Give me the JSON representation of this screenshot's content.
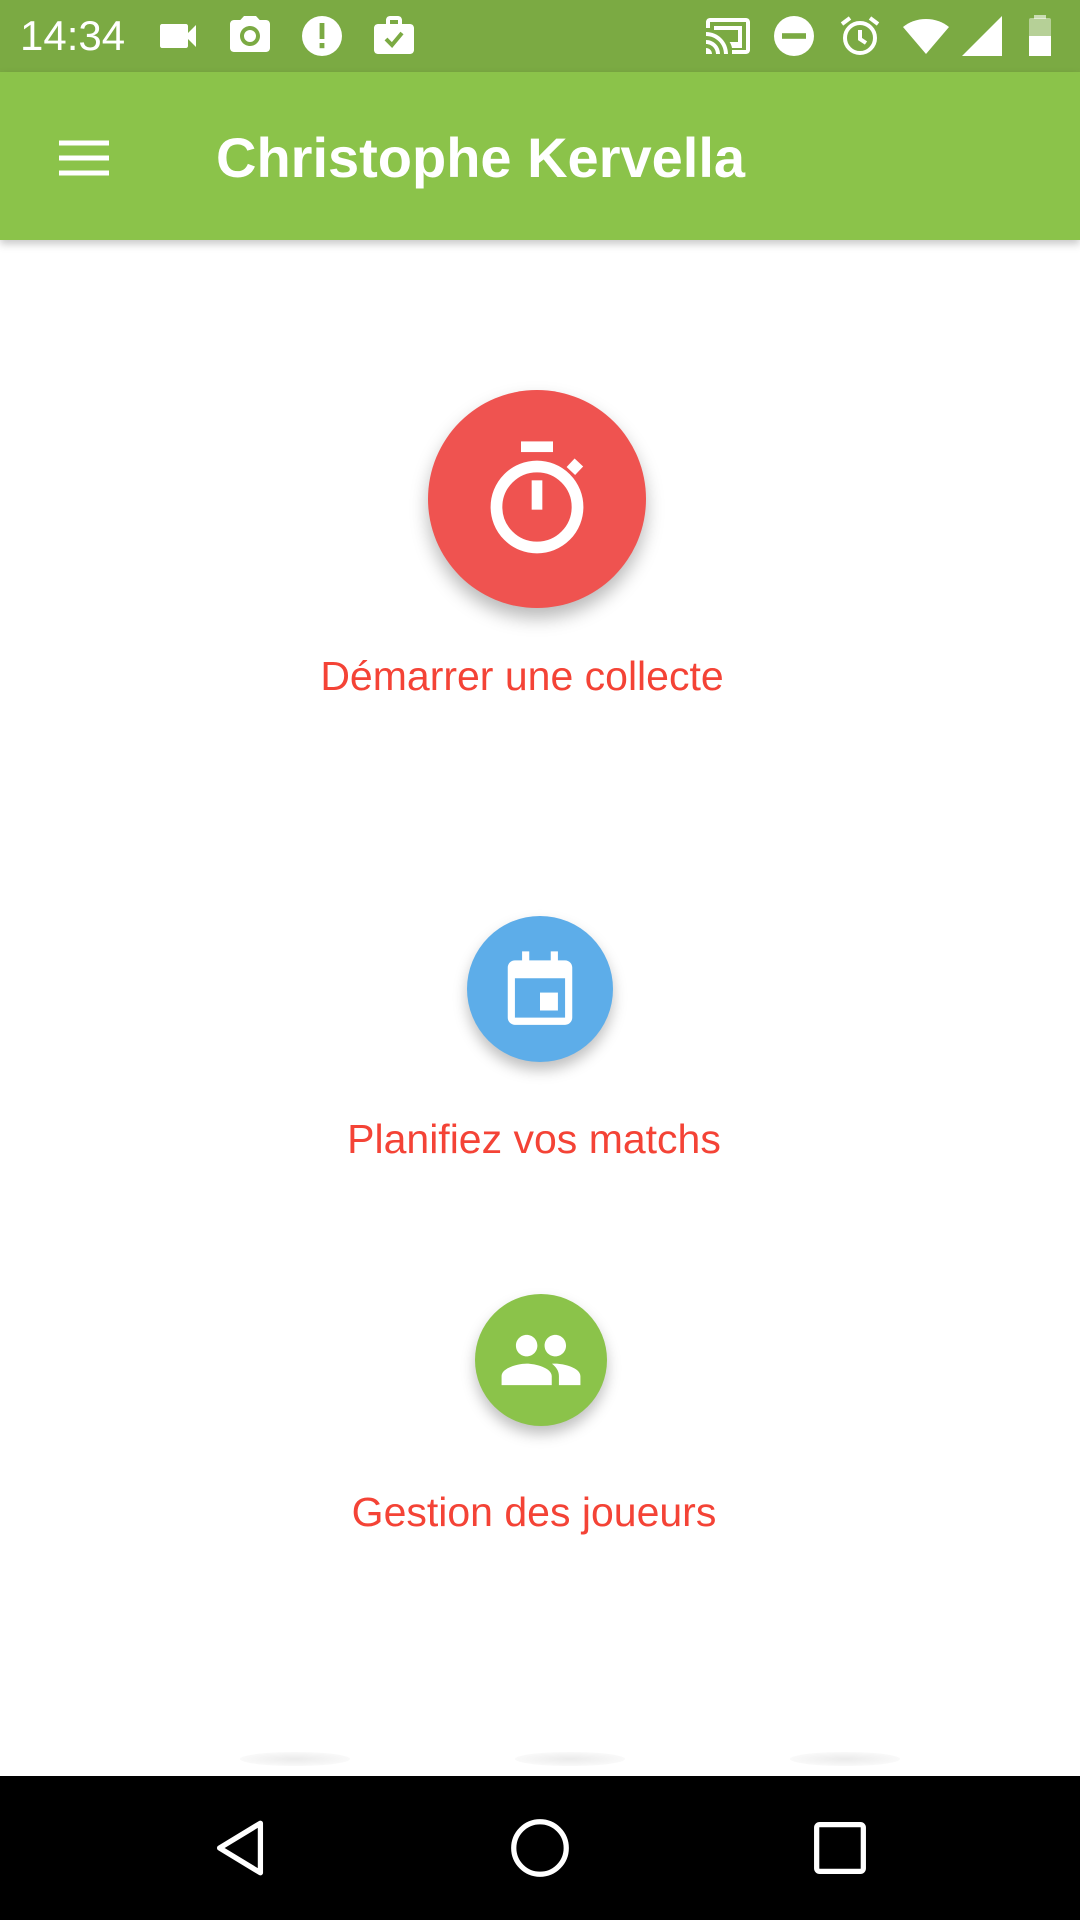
{
  "status_bar": {
    "time": "14:34",
    "left_icons": [
      "video-camera-icon",
      "camera-icon",
      "alert-icon",
      "work-check-icon"
    ],
    "right_icons": [
      "cast-icon",
      "do-not-disturb-icon",
      "alarm-icon",
      "wifi-icon",
      "signal-icon",
      "battery-icon"
    ],
    "background": "#7BAA43"
  },
  "app_bar": {
    "title": "Christophe Kervella",
    "background": "#8BC34A"
  },
  "actions": [
    {
      "id": "collect",
      "label": "Démarrer une collecte",
      "icon": "stopwatch-icon",
      "color": "#EF5350"
    },
    {
      "id": "matchs",
      "label": "Planifiez vos matchs",
      "icon": "calendar-icon",
      "color": "#5DADE9"
    },
    {
      "id": "players",
      "label": "Gestion des joueurs",
      "icon": "people-icon",
      "color": "#8BC34A"
    }
  ],
  "label_color": "#F44336",
  "nav_bar": {
    "buttons": [
      "back-icon",
      "home-icon",
      "recents-icon"
    ]
  }
}
